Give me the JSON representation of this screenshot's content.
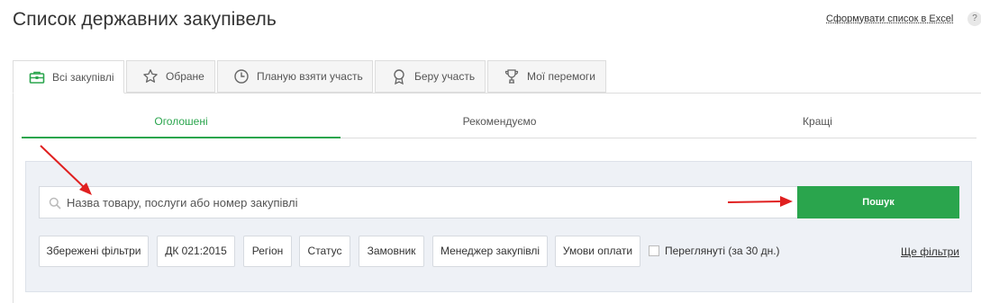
{
  "header": {
    "title": "Список державних закупівель",
    "excel_link": "Сформувати список в Excel",
    "help_label": "?"
  },
  "tabs": [
    {
      "label": "Всі закупівлі",
      "icon": "briefcase-icon",
      "active": true
    },
    {
      "label": "Обране",
      "icon": "star-icon",
      "active": false
    },
    {
      "label": "Планую взяти участь",
      "icon": "clock-icon",
      "active": false
    },
    {
      "label": "Беру участь",
      "icon": "badge-icon",
      "active": false
    },
    {
      "label": "Мої перемоги",
      "icon": "trophy-icon",
      "active": false
    }
  ],
  "subtabs": [
    {
      "label": "Оголошені",
      "active": true
    },
    {
      "label": "Рекомендуємо",
      "active": false
    },
    {
      "label": "Кращі",
      "active": false
    }
  ],
  "search": {
    "placeholder": "Назва товару, послуги або номер закупівлі",
    "value": "",
    "button_label": "Пошук"
  },
  "filters": {
    "chips": [
      "Збережені фільтри",
      "ДК 021:2015",
      "Регіон",
      "Статус",
      "Замовник",
      "Менеджер закупівлі",
      "Умови оплати"
    ],
    "checkbox_label": "Переглянуті (за 30 дн.)",
    "checkbox_checked": false,
    "more_filters": "Ще фільтри"
  },
  "colors": {
    "accent": "#2aa54d",
    "annotation": "#e02020"
  }
}
